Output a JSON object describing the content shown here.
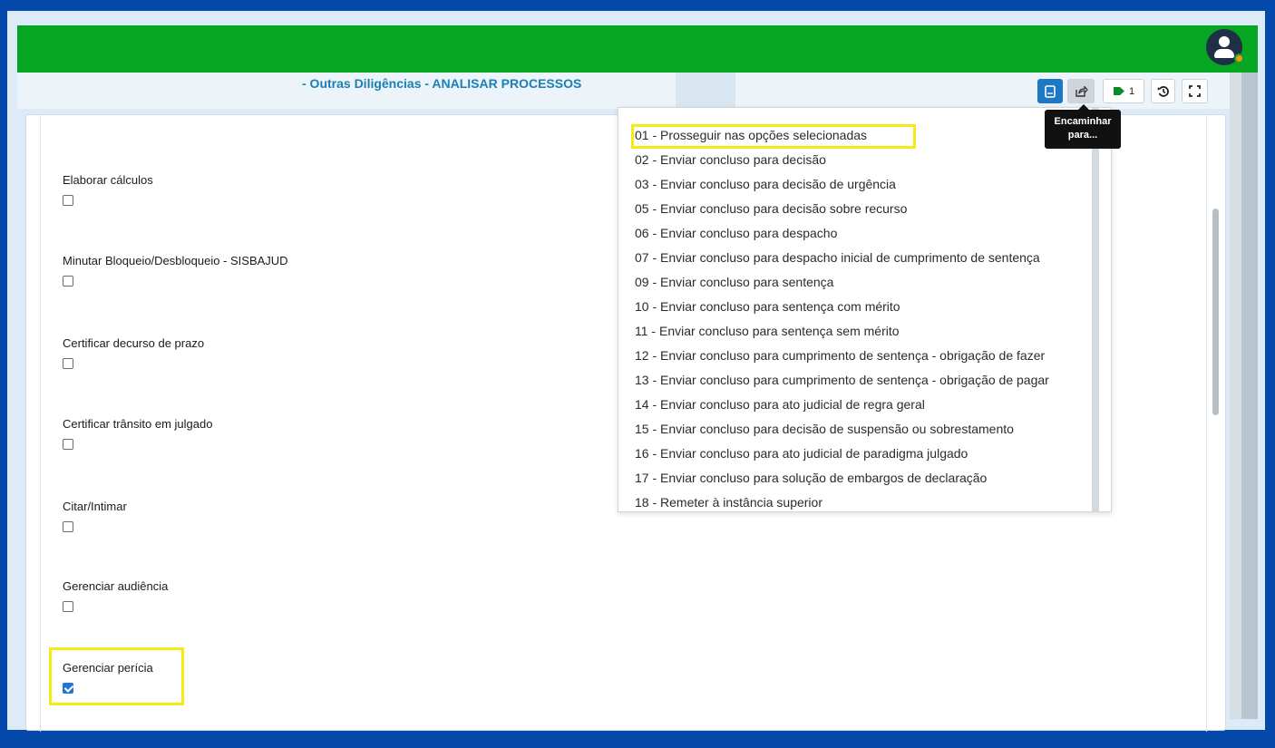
{
  "header": {
    "task_title": "- Outras Diligências - ANALISAR PROCESSOS"
  },
  "toolbar": {
    "tag_count": "1",
    "tooltip": "Encaminhar para..."
  },
  "fields": [
    {
      "label": "Elaborar cálculos",
      "checked": false
    },
    {
      "label": "Minutar Bloqueio/Desbloqueio - SISBAJUD",
      "checked": false
    },
    {
      "label": "Certificar decurso de prazo",
      "checked": false
    },
    {
      "label": "Certificar trânsito em julgado",
      "checked": false
    },
    {
      "label": "Citar/Intimar",
      "checked": false
    },
    {
      "label": "Gerenciar audiência",
      "checked": false
    },
    {
      "label": "Gerenciar perícia",
      "checked": true
    }
  ],
  "menu": {
    "items": [
      "01 - Prosseguir nas opções selecionadas",
      "02 - Enviar concluso para decisão",
      "03 - Enviar concluso para decisão de urgência",
      "05 - Enviar concluso para decisão sobre recurso",
      "06 - Enviar concluso para despacho",
      "07 - Enviar concluso para despacho inicial de cumprimento de sentença",
      "09 - Enviar concluso para sentença",
      "10 - Enviar concluso para sentença com mérito",
      "11 - Enviar concluso para sentença sem mérito",
      "12 - Enviar concluso para cumprimento de sentença - obrigação de fazer",
      "13 - Enviar concluso para cumprimento de sentença - obrigação de pagar",
      "14 - Enviar concluso para ato judicial de regra geral",
      "15 - Enviar concluso para decisão de suspensão ou sobrestamento",
      "16 - Enviar concluso para ato judicial de paradigma julgado",
      "17 - Enviar concluso para solução de embargos de declaração",
      "18 - Remeter à instância superior"
    ]
  },
  "colors": {
    "outer_border": "#054aab",
    "header_green": "#05a622",
    "title_blue": "#1a7fb5",
    "highlight_yellow": "#f6ea14"
  },
  "icons": {
    "avatar": "user-avatar-icon",
    "primary_tool": "document-icon",
    "forward_tool": "share-forward-icon",
    "tag_tool": "tag-icon",
    "history_tool": "history-icon",
    "fullscreen_tool": "fullscreen-icon"
  }
}
